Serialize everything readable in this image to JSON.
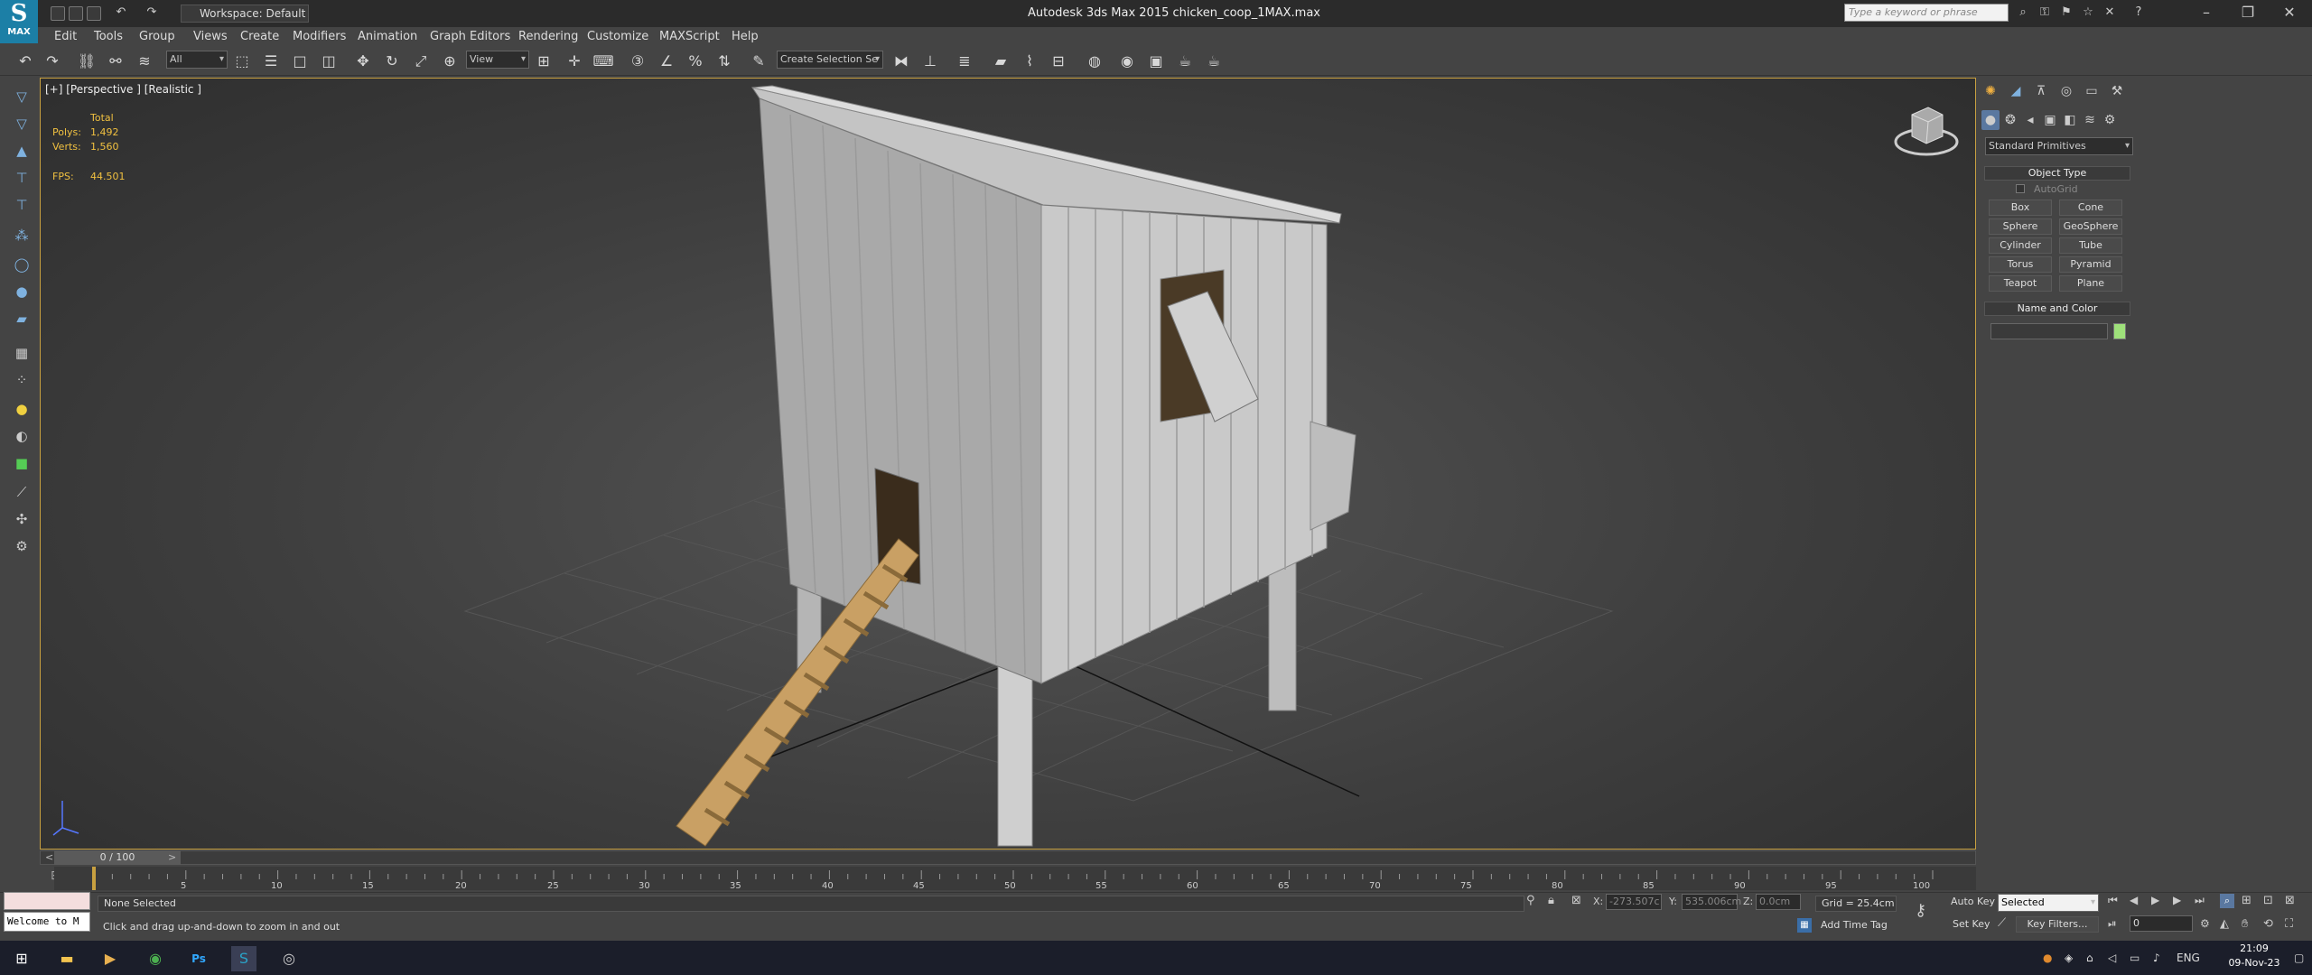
{
  "app": {
    "logo_label": "MAX",
    "workspace": "Workspace: Default",
    "title": "Autodesk 3ds Max  2015     chicken_coop_1MAX.max",
    "search_placeholder": "Type a keyword or phrase"
  },
  "menu": [
    "Edit",
    "Tools",
    "Group",
    "Views",
    "Create",
    "Modifiers",
    "Animation",
    "Graph Editors",
    "Rendering",
    "Customize",
    "MAXScript",
    "Help"
  ],
  "toolbar": {
    "filter_value": "All",
    "refcoord_value": "View",
    "selection_set_placeholder": "Create Selection Se"
  },
  "viewport": {
    "label": "[+] [Perspective ] [Realistic ]",
    "stats": {
      "total_label": "Total",
      "polys_label": "Polys:",
      "polys_value": "1,492",
      "verts_label": "Verts:",
      "verts_value": "1,560",
      "fps_label": "FPS:",
      "fps_value": "44.501"
    }
  },
  "command_panel": {
    "category": "Standard Primitives",
    "object_type_title": "Object Type",
    "autogrid_label": "AutoGrid",
    "buttons": [
      "Box",
      "Cone",
      "Sphere",
      "GeoSphere",
      "Cylinder",
      "Tube",
      "Torus",
      "Pyramid",
      "Teapot",
      "Plane"
    ],
    "name_color_title": "Name and Color",
    "swatch_color": "#9ee07a"
  },
  "timeline": {
    "slider_label": "0 / 100",
    "ticks": [
      "5",
      "10",
      "15",
      "20",
      "25",
      "30",
      "35",
      "40",
      "45",
      "50",
      "55",
      "60",
      "65",
      "70",
      "75",
      "80",
      "85",
      "90",
      "95",
      "100"
    ],
    "frame_progress": 0
  },
  "status": {
    "selection": "None Selected",
    "prompt": "Click and drag up-and-down to zoom in and out",
    "welcome": "Welcome to M",
    "x_label": "X:",
    "x_value": "-273.507c",
    "y_label": "Y:",
    "y_value": "535.006cm",
    "z_label": "Z:",
    "z_value": "0.0cm",
    "grid": "Grid = 25.4cm",
    "add_time_tag": "Add Time Tag",
    "auto_key": "Auto Key",
    "auto_key_value": "Selected",
    "set_key": "Set Key",
    "key_filters": "Key Filters...",
    "frame_value": "0"
  },
  "taskbar": {
    "lang": "ENG",
    "time": "21:09",
    "date": "09-Nov-23"
  }
}
